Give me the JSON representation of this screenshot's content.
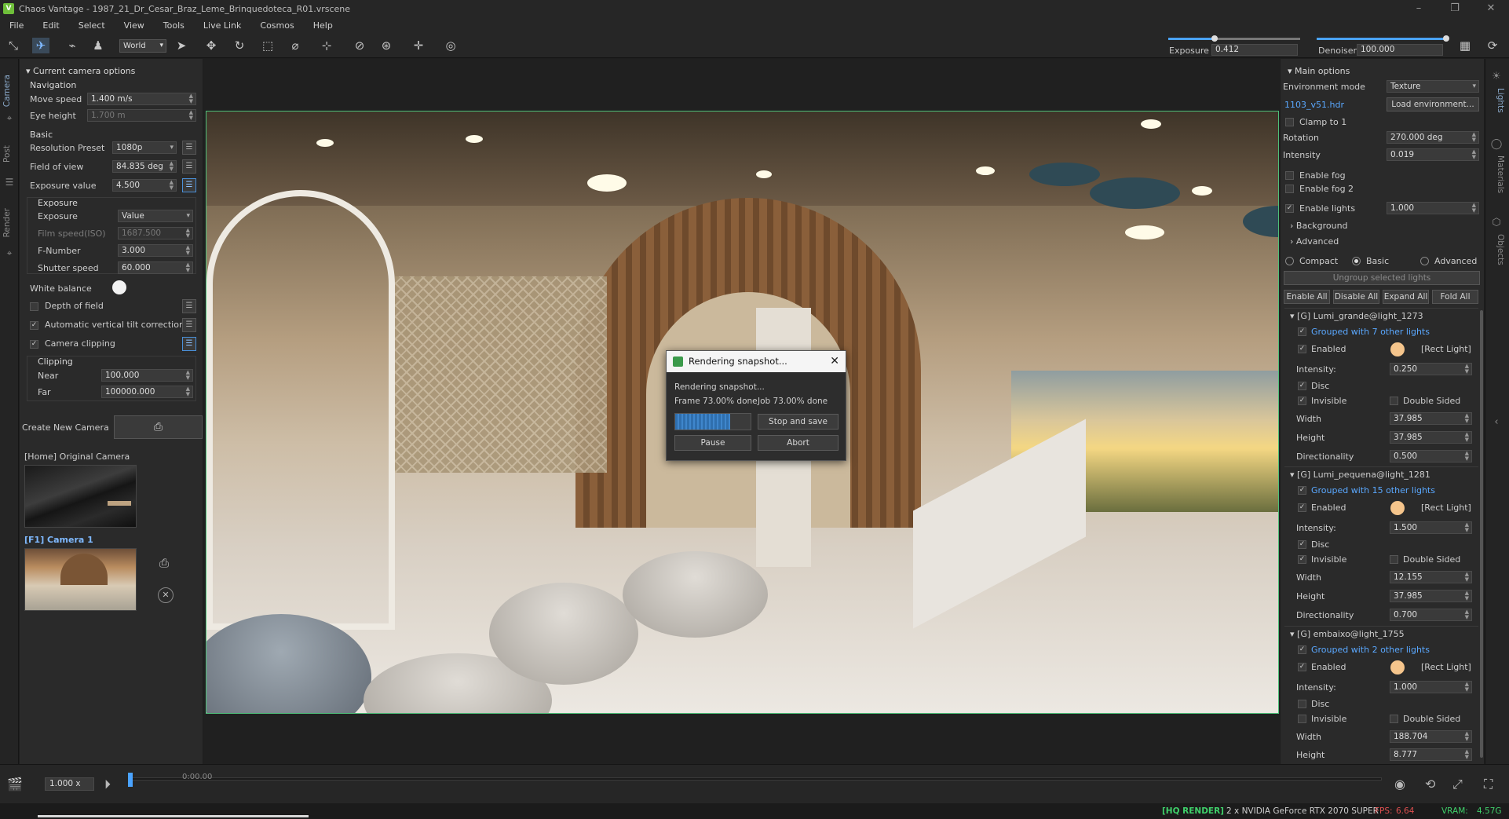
{
  "window": {
    "title": "Chaos Vantage - 1987_21_Dr_Cesar_Braz_Leme_Brinquedoteca_R01.vrscene"
  },
  "menu": [
    "File",
    "Edit",
    "Select",
    "View",
    "Tools",
    "Live Link",
    "Cosmos",
    "Help"
  ],
  "toolbar": {
    "space": "World",
    "exposure_label": "Exposure",
    "exposure_value": "0.412",
    "exposure_slider": 0.35,
    "denoiser_label": "Denoiser",
    "denoiser_value": "100.000",
    "denoiser_slider": 1.0,
    "accent": "#4aa3ff"
  },
  "left_tabs": [
    "Camera",
    "Post",
    "Render"
  ],
  "camera": {
    "section_title": "Current camera options",
    "navigation_head": "Navigation",
    "move_speed_label": "Move speed",
    "move_speed": "1.400 m/s",
    "eye_height_label": "Eye height",
    "eye_height": "1.700 m",
    "basic_head": "Basic",
    "resolution_label": "Resolution Preset",
    "resolution": "1080p",
    "fov_label": "Field of view",
    "fov": "84.835 deg",
    "exposure_value_label": "Exposure value",
    "exposure_value": "4.500",
    "exposure_head": "Exposure",
    "exposure_label": "Exposure",
    "exposure_mode": "Value",
    "film_speed_label": "Film speed(ISO)",
    "film_speed": "1687.500",
    "fnumber_label": "F-Number",
    "fnumber": "3.000",
    "shutter_label": "Shutter speed",
    "shutter": "60.000",
    "white_balance_label": "White balance",
    "dof_label": "Depth of field",
    "tilt_label": "Automatic vertical tilt correction",
    "clipping_toggle_label": "Camera clipping",
    "clipping_head": "Clipping",
    "near_label": "Near",
    "near": "100.000",
    "far_label": "Far",
    "far": "100000.000",
    "create_camera_label": "Create New Camera",
    "cam1_label": "[Home] Original Camera",
    "cam2_label": "[F1] Camera 1"
  },
  "dialog": {
    "title": "Rendering snapshot...",
    "status": "Rendering snapshot...",
    "frame_text": "Frame 73.00% done",
    "job_text": "Job 73.00% done",
    "progress": 0.73,
    "stop_save": "Stop and save",
    "pause": "Pause",
    "abort": "Abort"
  },
  "lights": {
    "main_head": "Main options",
    "env_mode_label": "Environment mode",
    "env_mode": "Texture",
    "hdr_name": "1103_v51.hdr",
    "load_env": "Load environment...",
    "clamp_label": "Clamp to 1",
    "rotation_label": "Rotation",
    "rotation": "270.000 deg",
    "intensity_label": "Intensity",
    "intensity": "0.019",
    "fog_label": "Enable fog",
    "fog2_label": "Enable fog 2",
    "enable_lights_label": "Enable lights",
    "enable_lights_value": "1.000",
    "background_label": "Background",
    "advanced_label": "Advanced",
    "view_compact": "Compact",
    "view_basic": "Basic",
    "view_advanced": "Advanced",
    "ungroup": "Ungroup selected lights",
    "enable_all": "Enable All",
    "disable_all": "Disable All",
    "expand_all": "Expand All",
    "fold_all": "Fold All",
    "enabled_word": "Enabled",
    "type_word": "[Rect Light]",
    "intensity_word": "Intensity:",
    "disc_word": "Disc",
    "invisible_word": "Invisible",
    "double_word": "Double Sided",
    "width_word": "Width",
    "height_word": "Height",
    "dir_word": "Directionality",
    "groups": [
      {
        "name": "[G] Lumi_grande@light_1273",
        "grouped": "Grouped with 7 other lights",
        "intensity": "0.250",
        "width": "37.985",
        "height": "37.985",
        "directionality": "0.500"
      },
      {
        "name": "[G] Lumi_pequena@light_1281",
        "grouped": "Grouped with 15 other lights",
        "intensity": "1.500",
        "width": "12.155",
        "height": "37.985",
        "directionality": "0.700"
      },
      {
        "name": "[G] embaixo@light_1755",
        "grouped": "Grouped with 2 other lights",
        "intensity": "1.000",
        "width": "188.704",
        "height": "8.777"
      }
    ]
  },
  "right_tabs": [
    "Lights",
    "Materials",
    "Objects"
  ],
  "timeline": {
    "speed": "1.000 x",
    "time": "0:00.00"
  },
  "status": {
    "mode": "[HQ RENDER]",
    "gpu": "2 x NVIDIA GeForce RTX 2070 SUPER",
    "fps_label": "FPS:",
    "fps": "6.64",
    "vram_label": "VRAM:",
    "vram": "4.57G"
  }
}
